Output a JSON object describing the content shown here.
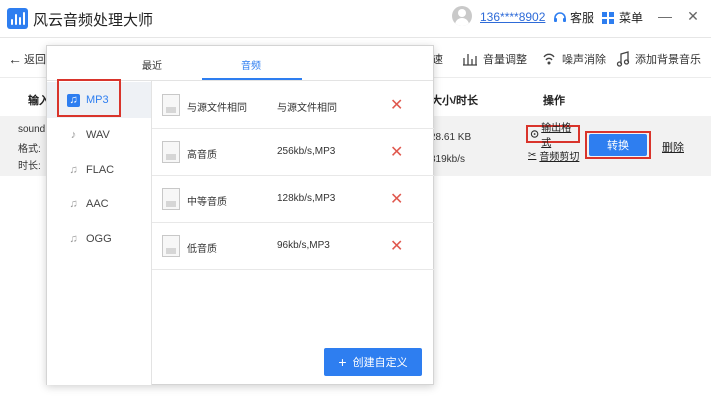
{
  "app": {
    "title": "风云音频处理大师"
  },
  "header": {
    "phone": "136****8902",
    "service_label": "客服",
    "menu_label": "菜单"
  },
  "toolbar": {
    "back_label": "返回",
    "items": [
      {
        "label": "速"
      },
      {
        "label": "音量调整"
      },
      {
        "label": "噪声消除"
      },
      {
        "label": "添加背景音乐"
      }
    ]
  },
  "list": {
    "header_input": "输入",
    "header_size": "大小/时长",
    "header_action": "操作",
    "file": {
      "name": "sound",
      "format_label": "格式:",
      "duration_label": "时长:",
      "size": "28.61 KB",
      "duration": "319kb/s"
    },
    "output_format_label": "输出格式",
    "cut_label": "音频剪切",
    "convert_label": "转换",
    "delete_label": "删除"
  },
  "popup": {
    "tabs": [
      {
        "label": "最近"
      },
      {
        "label": "音频"
      }
    ],
    "formats": [
      {
        "label": "MP3"
      },
      {
        "label": "WAV"
      },
      {
        "label": "FLAC"
      },
      {
        "label": "AAC"
      },
      {
        "label": "OGG"
      }
    ],
    "qualities": [
      {
        "name": "与源文件相同",
        "value": "与源文件相同"
      },
      {
        "name": "高音质",
        "value": "256kb/s,MP3"
      },
      {
        "name": "中等音质",
        "value": "128kb/s,MP3"
      },
      {
        "name": "低音质",
        "value": "96kb/s,MP3"
      }
    ],
    "create_label": "创建自定义"
  },
  "colors": {
    "accent": "#2e7ef0",
    "highlight": "#d9342b",
    "delete": "#e0584e"
  }
}
